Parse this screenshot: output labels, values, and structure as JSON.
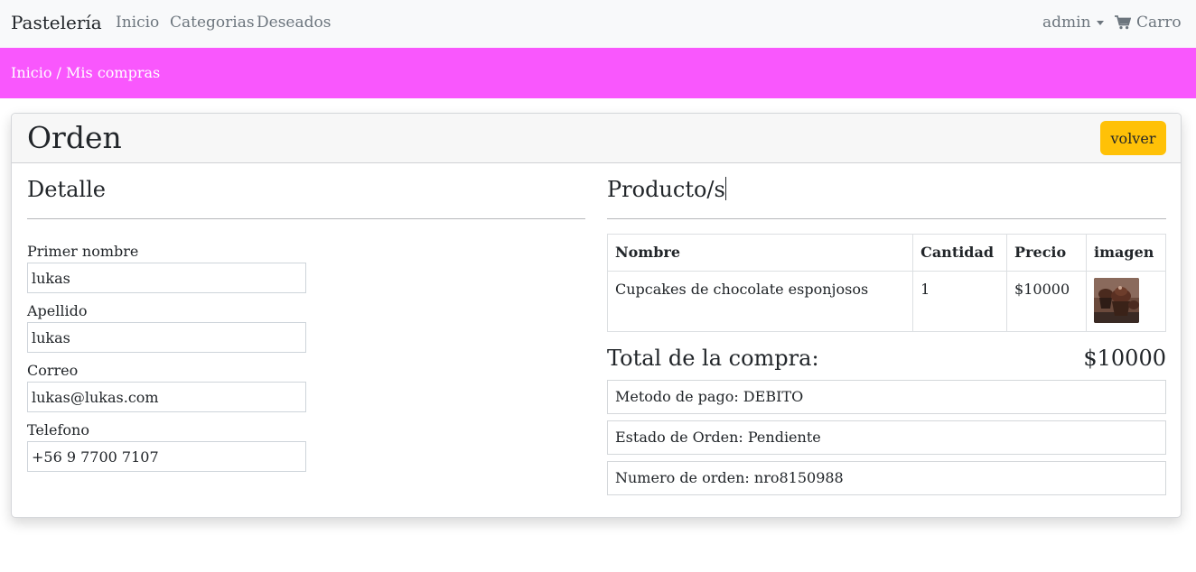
{
  "navbar": {
    "brand": "Pastelería",
    "links": [
      "Inicio",
      "Categorias",
      "Deseados"
    ],
    "user": "admin",
    "cart": "Carro"
  },
  "breadcrumb": {
    "home": "Inicio",
    "separator": " / ",
    "current": "Mis compras",
    "bar_color": "#f957fd"
  },
  "order": {
    "title": "Orden",
    "back_button": "volver",
    "detail": {
      "title": "Detalle",
      "fields": [
        {
          "label": "Primer nombre",
          "value": "lukas"
        },
        {
          "label": "Apellido",
          "value": "lukas"
        },
        {
          "label": "Correo",
          "value": "lukas@lukas.com"
        },
        {
          "label": "Telefono",
          "value": "+56 9 7700 7107"
        }
      ]
    },
    "products": {
      "title": "Producto/s",
      "columns": [
        "Nombre",
        "Cantidad",
        "Precio",
        "imagen"
      ],
      "rows": [
        {
          "name": "Cupcakes de chocolate esponjosos",
          "quantity": "1",
          "price": "$10000",
          "image_icon": "cupcake-image"
        }
      ]
    },
    "total": {
      "label": "Total de la compra:",
      "value": "$10000"
    },
    "info": [
      "Metodo de pago: DEBITO",
      "Estado de Orden: Pendiente",
      "Numero de orden: nro8150988"
    ]
  }
}
